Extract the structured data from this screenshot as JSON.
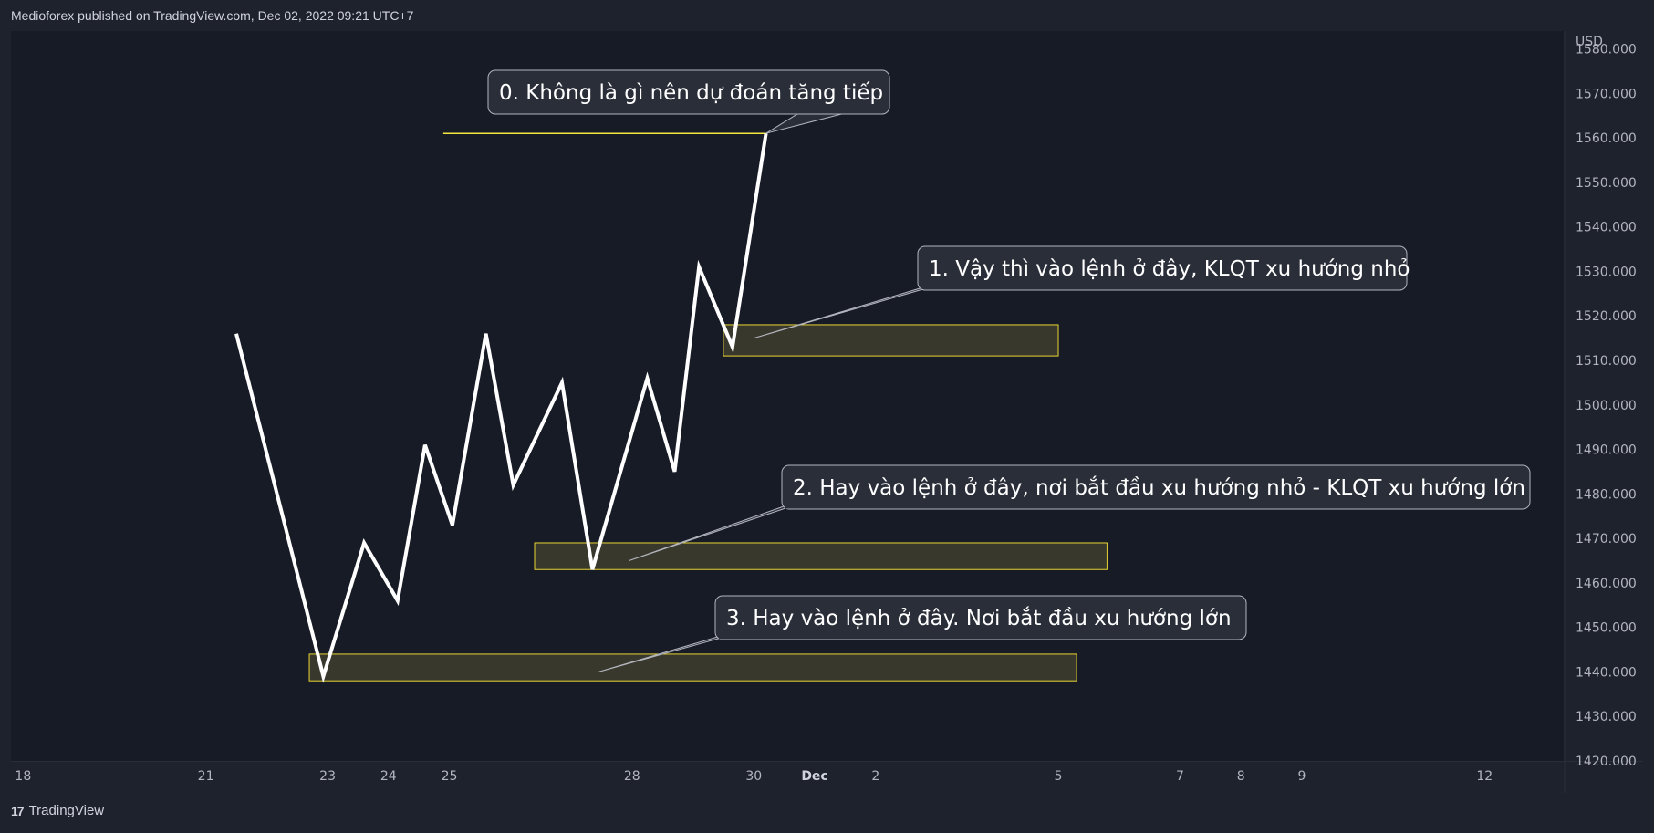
{
  "header": {
    "title": "Medioforex published on TradingView.com, Dec 02, 2022 09:21 UTC+7"
  },
  "footer": {
    "brand": "TradingView",
    "logo_glyph": "17"
  },
  "colors": {
    "background": "#1e222d",
    "plot_background": "#171b26",
    "price_line": "#ffffff",
    "zone_fill": "#3d3c2e",
    "zone_border": "#e8d433",
    "level_line": "#f5e642",
    "callout_fill": "#2a2e39",
    "callout_border": "#b2b5be",
    "axis_text": "#b2b5be"
  },
  "chart_data": {
    "type": "line",
    "y_axis": {
      "currency": "USD",
      "range": [
        1420,
        1584
      ],
      "tick_labels": [
        "1420.000",
        "1430.000",
        "1440.000",
        "1450.000",
        "1460.000",
        "1470.000",
        "1480.000",
        "1490.000",
        "1500.000",
        "1510.000",
        "1520.000",
        "1530.000",
        "1540.000",
        "1550.000",
        "1560.000",
        "1570.000",
        "1580.000"
      ]
    },
    "x_axis": {
      "range": [
        17.8,
        43.3
      ],
      "ticks": [
        {
          "x": 18,
          "label": "18"
        },
        {
          "x": 21,
          "label": "21"
        },
        {
          "x": 23,
          "label": "23"
        },
        {
          "x": 24,
          "label": "24"
        },
        {
          "x": 25,
          "label": "25"
        },
        {
          "x": 28,
          "label": "28"
        },
        {
          "x": 30,
          "label": "30"
        },
        {
          "x": 31,
          "label": "Dec",
          "bold": true
        },
        {
          "x": 32,
          "label": "2"
        },
        {
          "x": 35,
          "label": "5"
        },
        {
          "x": 37,
          "label": "7"
        },
        {
          "x": 38,
          "label": "8"
        },
        {
          "x": 39,
          "label": "9"
        },
        {
          "x": 42,
          "label": "12"
        }
      ]
    },
    "series": [
      {
        "points": [
          [
            21.5,
            1516
          ],
          [
            22.93,
            1439
          ],
          [
            23.6,
            1469
          ],
          [
            24.15,
            1456
          ],
          [
            24.6,
            1491
          ],
          [
            25.05,
            1473
          ],
          [
            25.6,
            1516
          ],
          [
            26.05,
            1482
          ],
          [
            26.85,
            1505
          ],
          [
            27.35,
            1463
          ],
          [
            28.25,
            1506
          ],
          [
            28.7,
            1485
          ],
          [
            29.1,
            1531
          ],
          [
            29.65,
            1513
          ],
          [
            30.2,
            1561
          ]
        ]
      }
    ],
    "zones": [
      {
        "x_start": 29.5,
        "x_end": 35.0,
        "y_low": 1511,
        "y_high": 1518
      },
      {
        "x_start": 26.4,
        "x_end": 35.8,
        "y_low": 1463,
        "y_high": 1469
      },
      {
        "x_start": 22.7,
        "x_end": 35.3,
        "y_low": 1438,
        "y_high": 1444
      }
    ],
    "level_lines": [
      {
        "x_start": 24.9,
        "x_end": 30.2,
        "y": 1561
      }
    ],
    "annotations": [
      {
        "text": "0. Không là gì nên dự đoán tăng tiếp",
        "anchor": [
          30.2,
          1561
        ]
      },
      {
        "text": "1. Vậy thì vào lệnh ở đây, KLQT xu hướng nhỏ",
        "anchor": [
          30.0,
          1515
        ]
      },
      {
        "text": "2. Hay vào lệnh ở đây, nơi bắt đầu xu hướng nhỏ - KLQT xu hướng lớn",
        "anchor": [
          27.95,
          1465
        ]
      },
      {
        "text": "3. Hay vào lệnh ở đây. Nơi bắt đầu xu hướng lớn",
        "anchor": [
          27.45,
          1440
        ]
      }
    ]
  }
}
